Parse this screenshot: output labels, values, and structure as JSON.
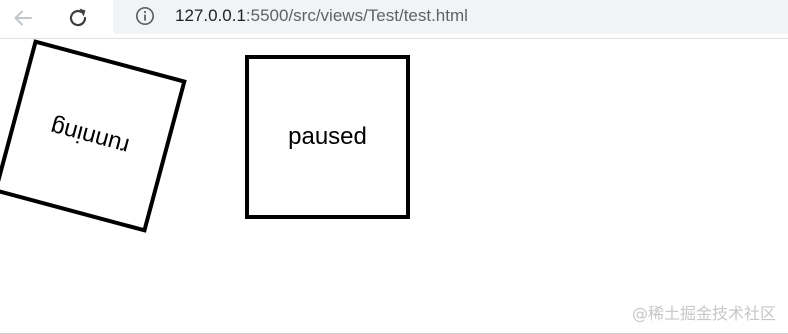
{
  "browser": {
    "url_host": "127.0.0.1",
    "url_rest": ":5500/src/views/Test/test.html"
  },
  "page": {
    "box_running_label": "running",
    "box_paused_label": "paused"
  },
  "watermark": "@稀土掘金技术社区",
  "colors": {
    "toolbar_bg": "#ffffff",
    "addressbar_bg": "#f1f3f4",
    "icon_gray": "#5f6368",
    "icon_disabled": "#c4c7c9",
    "box_border": "#000000"
  },
  "icons": [
    "back-arrow-icon",
    "reload-icon",
    "info-icon"
  ]
}
